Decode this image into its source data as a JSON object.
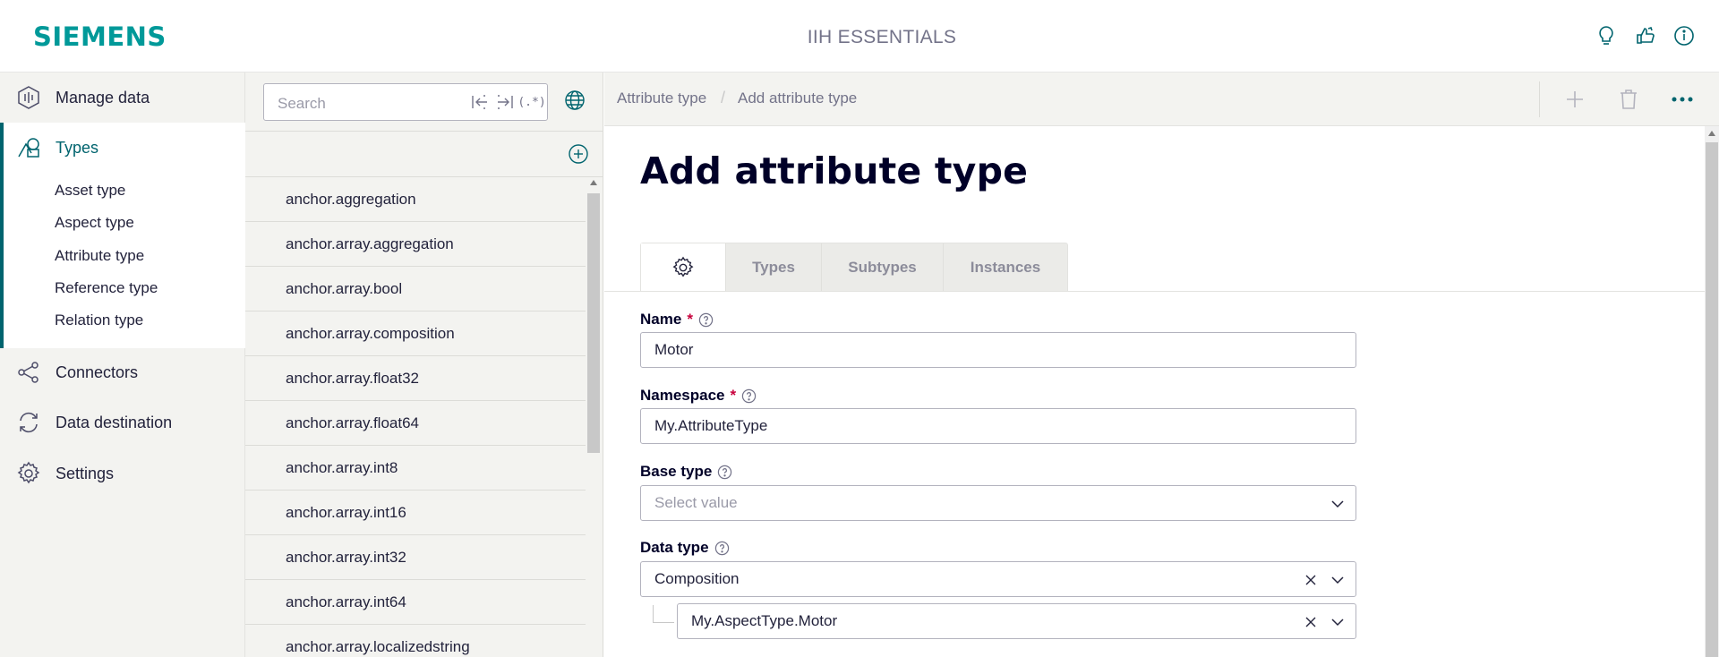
{
  "header": {
    "logo": "SIEMENS",
    "app_title": "IIH ESSENTIALS",
    "icons": [
      "lightbulb-icon",
      "feedback-icon",
      "info-icon"
    ]
  },
  "nav": {
    "items": [
      {
        "label": "Manage data",
        "icon": "manage-data-icon"
      },
      {
        "label": "Types",
        "icon": "types-icon",
        "active": true
      },
      {
        "label": "Connectors",
        "icon": "share-nodes-icon"
      },
      {
        "label": "Data destination",
        "icon": "sync-icon"
      },
      {
        "label": "Settings",
        "icon": "gear-icon"
      }
    ],
    "types_sub": [
      "Asset type",
      "Aspect type",
      "Attribute type",
      "Reference type",
      "Relation type"
    ]
  },
  "list_pane": {
    "search_placeholder": "Search",
    "regex_label": "(.*)",
    "rows": [
      "anchor.aggregation",
      "anchor.array.aggregation",
      "anchor.array.bool",
      "anchor.array.composition",
      "anchor.array.float32",
      "anchor.array.float64",
      "anchor.array.int8",
      "anchor.array.int16",
      "anchor.array.int32",
      "anchor.array.int64",
      "anchor.array.localizedstring"
    ]
  },
  "content": {
    "breadcrumb": [
      "Attribute type",
      "Add attribute type"
    ],
    "title": "Add attribute type",
    "tabs": [
      "Types",
      "Subtypes",
      "Instances"
    ],
    "fields": {
      "name": {
        "label": "Name",
        "value": "Motor"
      },
      "namespace": {
        "label": "Namespace",
        "value": "My.AttributeType"
      },
      "base_type": {
        "label": "Base type",
        "placeholder": "Select value"
      },
      "data_type": {
        "label": "Data type",
        "value": "Composition"
      },
      "composition_ref": {
        "value": "My.AspectType.Motor"
      }
    }
  },
  "colors": {
    "brand": "#009999",
    "accent": "#00646e",
    "required": "#c8003c",
    "nav_bg": "#f3f3f0"
  }
}
